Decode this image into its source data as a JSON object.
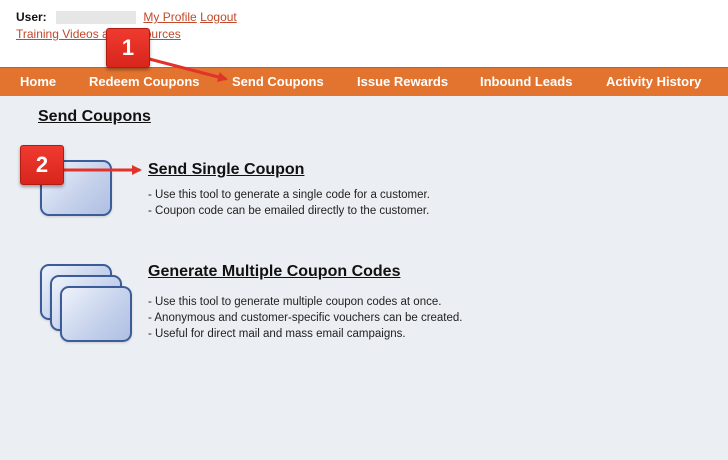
{
  "header": {
    "user_label": "User:",
    "my_profile": "My Profile",
    "logout": "Logout",
    "training_prefix": "Training Videos a",
    "training_suffix": "ources"
  },
  "nav": {
    "items": [
      "Home",
      "Redeem Coupons",
      "Send Coupons",
      "Issue Rewards",
      "Inbound Leads",
      "Activity History"
    ]
  },
  "page": {
    "title": "Send Coupons"
  },
  "tools": [
    {
      "title": "Send Single Coupon",
      "lines": [
        "- Use this tool to generate a single code for a customer.",
        "- Coupon code can be emailed directly to the customer."
      ]
    },
    {
      "title": "Generate Multiple Coupon Codes",
      "lines": [
        "- Use this tool to generate multiple coupon codes at once.",
        "- Anonymous and customer-specific vouchers can be created.",
        "- Useful for direct mail and mass email campaigns."
      ]
    }
  ],
  "callouts": [
    "1",
    "2"
  ],
  "colors": {
    "nav_bg": "#e2742f",
    "link": "#c2492b",
    "callout": "#e2332a",
    "content_bg": "#ebeef2"
  }
}
